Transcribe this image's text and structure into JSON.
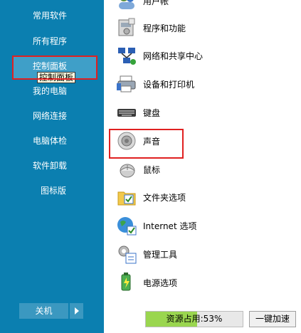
{
  "sidebar": {
    "items": [
      {
        "label": "常用软件"
      },
      {
        "label": "所有程序"
      },
      {
        "label": "控制面板"
      },
      {
        "label": "我的电脑"
      },
      {
        "label": "网络连接"
      },
      {
        "label": "电脑体检"
      },
      {
        "label": "软件卸载"
      },
      {
        "label": "图标版"
      }
    ],
    "tooltip": "控制面板",
    "shutdown_label": "关机",
    "background": "#0b7fb0"
  },
  "control_panel": {
    "items": [
      {
        "label": "用户帐",
        "icon": "users-icon"
      },
      {
        "label": "程序和功能",
        "icon": "programs-icon"
      },
      {
        "label": "网络和共享中心",
        "icon": "network-icon"
      },
      {
        "label": "设备和打印机",
        "icon": "printer-icon"
      },
      {
        "label": "键盘",
        "icon": "keyboard-icon"
      },
      {
        "label": "声音",
        "icon": "speaker-icon"
      },
      {
        "label": "鼠标",
        "icon": "mouse-icon"
      },
      {
        "label": "文件夹选项",
        "icon": "folder-icon"
      },
      {
        "label": "Internet 选项",
        "icon": "globe-icon"
      },
      {
        "label": "管理工具",
        "icon": "admin-tools-icon"
      },
      {
        "label": "电源选项",
        "icon": "power-icon"
      }
    ]
  },
  "status": {
    "resource_label": "资源占用:53%",
    "resource_fraction": 0.53,
    "speedup_label": "一键加速"
  },
  "highlight_color": "#e02020"
}
